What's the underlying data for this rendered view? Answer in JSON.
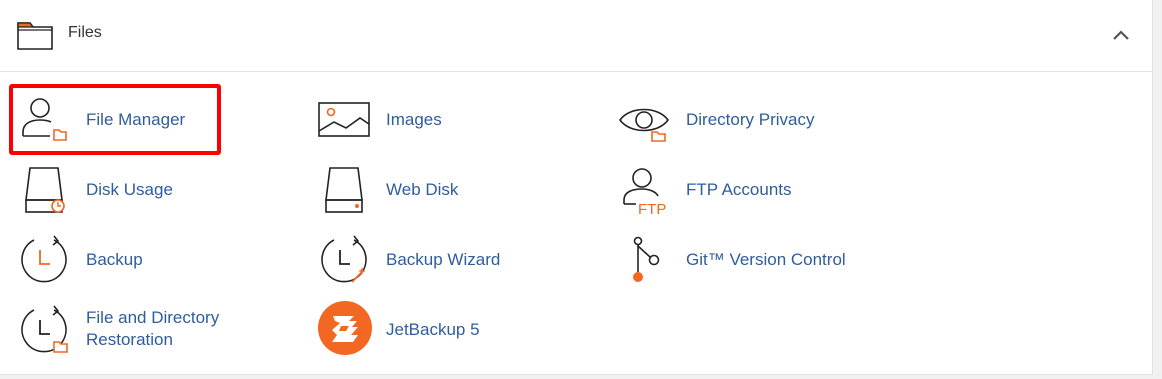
{
  "section": {
    "title": "Files",
    "collapse_icon": "chevron-up-icon",
    "header_icon": "folder-icon"
  },
  "colors": {
    "link": "#2f5d9c",
    "accent": "#f26722",
    "icon_stroke": "#222222",
    "highlight": "#ff0000"
  },
  "items": [
    {
      "label": "File Manager",
      "icon": "file-manager-icon",
      "highlighted": true
    },
    {
      "label": "Images",
      "icon": "images-icon"
    },
    {
      "label": "Directory Privacy",
      "icon": "directory-privacy-icon"
    },
    {
      "label": "Disk Usage",
      "icon": "disk-usage-icon"
    },
    {
      "label": "Web Disk",
      "icon": "web-disk-icon"
    },
    {
      "label": "FTP Accounts",
      "icon": "ftp-accounts-icon",
      "icon_text": "FTP"
    },
    {
      "label": "Backup",
      "icon": "backup-icon"
    },
    {
      "label": "Backup Wizard",
      "icon": "backup-wizard-icon"
    },
    {
      "label": "Git™ Version Control",
      "icon": "git-icon"
    },
    {
      "label_line1": "File and Directory",
      "label_line2": "Restoration",
      "icon": "restoration-icon"
    },
    {
      "label": "JetBackup 5",
      "icon": "jetbackup-icon"
    }
  ]
}
